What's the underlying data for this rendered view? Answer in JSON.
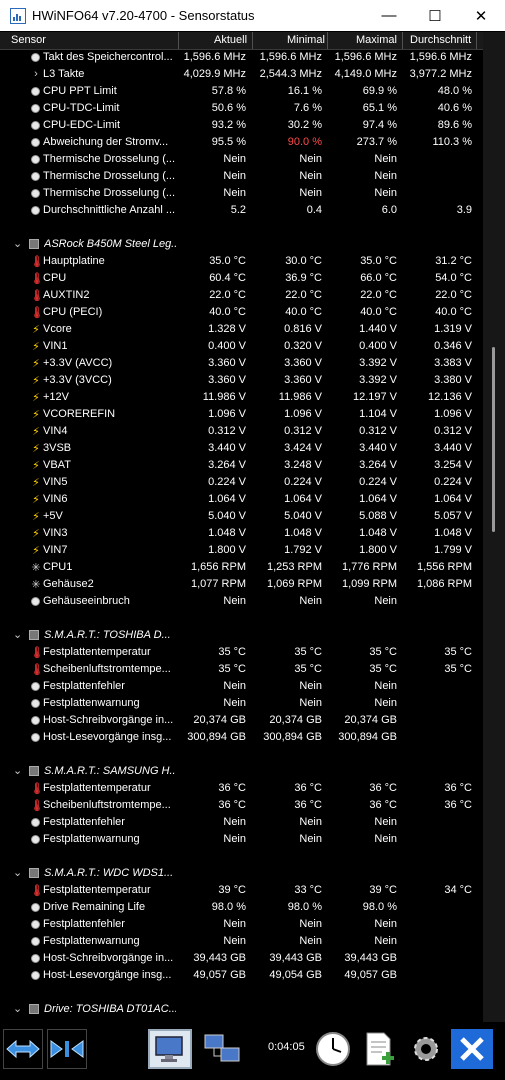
{
  "window": {
    "title": "HWiNFO64 v7.20-4700 - Sensorstatus",
    "minimize_glyph": "—",
    "maximize_glyph": "☐",
    "close_glyph": "✕"
  },
  "columns": {
    "sensor": "Sensor",
    "current": "Aktuell",
    "minimum": "Minimal",
    "maximum": "Maximal",
    "average": "Durchschnitt"
  },
  "rows": [
    {
      "kind": "item",
      "icon": "circle",
      "label": "Takt des Speichercontrol...",
      "cur": "1,596.6 MHz",
      "min": "1,596.6 MHz",
      "max": "1,596.6 MHz",
      "avg": "1,596.6 MHz"
    },
    {
      "kind": "item",
      "icon": "chevron",
      "label": "L3 Takte",
      "cur": "4,029.9 MHz",
      "min": "2,544.3 MHz",
      "max": "4,149.0 MHz",
      "avg": "3,977.2 MHz"
    },
    {
      "kind": "item",
      "icon": "circle",
      "label": "CPU PPT Limit",
      "cur": "57.8 %",
      "min": "16.1 %",
      "max": "69.9 %",
      "avg": "48.0 %"
    },
    {
      "kind": "item",
      "icon": "circle",
      "label": "CPU-TDC-Limit",
      "cur": "50.6 %",
      "min": "7.6 %",
      "max": "65.1 %",
      "avg": "40.6 %"
    },
    {
      "kind": "item",
      "icon": "circle",
      "label": "CPU-EDC-Limit",
      "cur": "93.2 %",
      "min": "30.2 %",
      "max": "97.4 %",
      "avg": "89.6 %"
    },
    {
      "kind": "item",
      "icon": "circle",
      "label": "Abweichung der Stromv...",
      "cur": "95.5 %",
      "min": "90.0 %",
      "min_red": true,
      "max": "273.7 %",
      "avg": "110.3 %"
    },
    {
      "kind": "item",
      "icon": "circle",
      "label": "Thermische Drosselung (...",
      "cur": "Nein",
      "min": "Nein",
      "max": "Nein",
      "avg": ""
    },
    {
      "kind": "item",
      "icon": "circle",
      "label": "Thermische Drosselung (...",
      "cur": "Nein",
      "min": "Nein",
      "max": "Nein",
      "avg": ""
    },
    {
      "kind": "item",
      "icon": "circle",
      "label": "Thermische Drosselung (...",
      "cur": "Nein",
      "min": "Nein",
      "max": "Nein",
      "avg": ""
    },
    {
      "kind": "item",
      "icon": "circle",
      "label": "Durchschnittliche Anzahl ...",
      "cur": "5.2",
      "min": "0.4",
      "max": "6.0",
      "avg": "3.9"
    },
    {
      "kind": "blank"
    },
    {
      "kind": "group",
      "label": "ASRock B450M Steel Leg..."
    },
    {
      "kind": "item",
      "icon": "therm",
      "label": "Hauptplatine",
      "cur": "35.0 °C",
      "min": "30.0 °C",
      "max": "35.0 °C",
      "avg": "31.2 °C"
    },
    {
      "kind": "item",
      "icon": "therm",
      "label": "CPU",
      "cur": "60.4 °C",
      "min": "36.9 °C",
      "max": "66.0 °C",
      "avg": "54.0 °C"
    },
    {
      "kind": "item",
      "icon": "therm",
      "label": "AUXTIN2",
      "cur": "22.0 °C",
      "min": "22.0 °C",
      "max": "22.0 °C",
      "avg": "22.0 °C"
    },
    {
      "kind": "item",
      "icon": "therm",
      "label": "CPU (PECI)",
      "cur": "40.0 °C",
      "min": "40.0 °C",
      "max": "40.0 °C",
      "avg": "40.0 °C"
    },
    {
      "kind": "item",
      "icon": "volt",
      "label": "Vcore",
      "cur": "1.328 V",
      "min": "0.816 V",
      "max": "1.440 V",
      "avg": "1.319 V"
    },
    {
      "kind": "item",
      "icon": "volt",
      "label": "VIN1",
      "cur": "0.400 V",
      "min": "0.320 V",
      "max": "0.400 V",
      "avg": "0.346 V"
    },
    {
      "kind": "item",
      "icon": "volt",
      "label": "+3.3V (AVCC)",
      "cur": "3.360 V",
      "min": "3.360 V",
      "max": "3.392 V",
      "avg": "3.383 V"
    },
    {
      "kind": "item",
      "icon": "volt",
      "label": "+3.3V (3VCC)",
      "cur": "3.360 V",
      "min": "3.360 V",
      "max": "3.392 V",
      "avg": "3.380 V"
    },
    {
      "kind": "item",
      "icon": "volt",
      "label": "+12V",
      "cur": "11.986 V",
      "min": "11.986 V",
      "max": "12.197 V",
      "avg": "12.136 V"
    },
    {
      "kind": "item",
      "icon": "volt",
      "label": "VCOREREFIN",
      "cur": "1.096 V",
      "min": "1.096 V",
      "max": "1.104 V",
      "avg": "1.096 V"
    },
    {
      "kind": "item",
      "icon": "volt",
      "label": "VIN4",
      "cur": "0.312 V",
      "min": "0.312 V",
      "max": "0.312 V",
      "avg": "0.312 V"
    },
    {
      "kind": "item",
      "icon": "volt",
      "label": "3VSB",
      "cur": "3.440 V",
      "min": "3.424 V",
      "max": "3.440 V",
      "avg": "3.440 V"
    },
    {
      "kind": "item",
      "icon": "volt",
      "label": "VBAT",
      "cur": "3.264 V",
      "min": "3.248 V",
      "max": "3.264 V",
      "avg": "3.254 V"
    },
    {
      "kind": "item",
      "icon": "volt",
      "label": "VIN5",
      "cur": "0.224 V",
      "min": "0.224 V",
      "max": "0.224 V",
      "avg": "0.224 V"
    },
    {
      "kind": "item",
      "icon": "volt",
      "label": "VIN6",
      "cur": "1.064 V",
      "min": "1.064 V",
      "max": "1.064 V",
      "avg": "1.064 V"
    },
    {
      "kind": "item",
      "icon": "volt",
      "label": "+5V",
      "cur": "5.040 V",
      "min": "5.040 V",
      "max": "5.088 V",
      "avg": "5.057 V"
    },
    {
      "kind": "item",
      "icon": "volt",
      "label": "VIN3",
      "cur": "1.048 V",
      "min": "1.048 V",
      "max": "1.048 V",
      "avg": "1.048 V"
    },
    {
      "kind": "item",
      "icon": "volt",
      "label": "VIN7",
      "cur": "1.800 V",
      "min": "1.792 V",
      "max": "1.800 V",
      "avg": "1.799 V"
    },
    {
      "kind": "item",
      "icon": "fan",
      "label": "CPU1",
      "cur": "1,656 RPM",
      "min": "1,253 RPM",
      "max": "1,776 RPM",
      "avg": "1,556 RPM"
    },
    {
      "kind": "item",
      "icon": "fan",
      "label": "Gehäuse2",
      "cur": "1,077 RPM",
      "min": "1,069 RPM",
      "max": "1,099 RPM",
      "avg": "1,086 RPM"
    },
    {
      "kind": "item",
      "icon": "circle",
      "label": "Gehäuseeinbruch",
      "cur": "Nein",
      "min": "Nein",
      "max": "Nein",
      "avg": ""
    },
    {
      "kind": "blank"
    },
    {
      "kind": "group",
      "label": "S.M.A.R.T.: TOSHIBA D..."
    },
    {
      "kind": "item",
      "icon": "therm",
      "label": "Festplattentemperatur",
      "cur": "35 °C",
      "min": "35 °C",
      "max": "35 °C",
      "avg": "35 °C"
    },
    {
      "kind": "item",
      "icon": "therm",
      "label": "Scheibenluftstromtempe...",
      "cur": "35 °C",
      "min": "35 °C",
      "max": "35 °C",
      "avg": "35 °C"
    },
    {
      "kind": "item",
      "icon": "circle",
      "label": "Festplattenfehler",
      "cur": "Nein",
      "min": "Nein",
      "max": "Nein",
      "avg": ""
    },
    {
      "kind": "item",
      "icon": "circle",
      "label": "Festplattenwarnung",
      "cur": "Nein",
      "min": "Nein",
      "max": "Nein",
      "avg": ""
    },
    {
      "kind": "item",
      "icon": "circle",
      "label": "Host-Schreibvorgänge in...",
      "cur": "20,374 GB",
      "min": "20,374 GB",
      "max": "20,374 GB",
      "avg": ""
    },
    {
      "kind": "item",
      "icon": "circle",
      "label": "Host-Lesevorgänge insg...",
      "cur": "300,894 GB",
      "min": "300,894 GB",
      "max": "300,894 GB",
      "avg": ""
    },
    {
      "kind": "blank"
    },
    {
      "kind": "group",
      "label": "S.M.A.R.T.: SAMSUNG H..."
    },
    {
      "kind": "item",
      "icon": "therm",
      "label": "Festplattentemperatur",
      "cur": "36 °C",
      "min": "36 °C",
      "max": "36 °C",
      "avg": "36 °C"
    },
    {
      "kind": "item",
      "icon": "therm",
      "label": "Scheibenluftstromtempe...",
      "cur": "36 °C",
      "min": "36 °C",
      "max": "36 °C",
      "avg": "36 °C"
    },
    {
      "kind": "item",
      "icon": "circle",
      "label": "Festplattenfehler",
      "cur": "Nein",
      "min": "Nein",
      "max": "Nein",
      "avg": ""
    },
    {
      "kind": "item",
      "icon": "circle",
      "label": "Festplattenwarnung",
      "cur": "Nein",
      "min": "Nein",
      "max": "Nein",
      "avg": ""
    },
    {
      "kind": "blank"
    },
    {
      "kind": "group",
      "label": "S.M.A.R.T.: WDC WDS1..."
    },
    {
      "kind": "item",
      "icon": "therm",
      "label": "Festplattentemperatur",
      "cur": "39 °C",
      "min": "33 °C",
      "max": "39 °C",
      "avg": "34 °C"
    },
    {
      "kind": "item",
      "icon": "circle",
      "label": "Drive Remaining Life",
      "cur": "98.0 %",
      "min": "98.0 %",
      "max": "98.0 %",
      "avg": ""
    },
    {
      "kind": "item",
      "icon": "circle",
      "label": "Festplattenfehler",
      "cur": "Nein",
      "min": "Nein",
      "max": "Nein",
      "avg": ""
    },
    {
      "kind": "item",
      "icon": "circle",
      "label": "Festplattenwarnung",
      "cur": "Nein",
      "min": "Nein",
      "max": "Nein",
      "avg": ""
    },
    {
      "kind": "item",
      "icon": "circle",
      "label": "Host-Schreibvorgänge in...",
      "cur": "39,443 GB",
      "min": "39,443 GB",
      "max": "39,443 GB",
      "avg": ""
    },
    {
      "kind": "item",
      "icon": "circle",
      "label": "Host-Lesevorgänge insg...",
      "cur": "49,057 GB",
      "min": "49,054 GB",
      "max": "49,057 GB",
      "avg": ""
    },
    {
      "kind": "blank"
    },
    {
      "kind": "group",
      "label": "Drive: TOSHIBA DT01AC..."
    }
  ],
  "icons": {
    "circle": "status-dot-icon",
    "chevron": "expand-chevron-icon",
    "therm": "thermometer-icon",
    "volt": "lightning-icon",
    "fan": "fan-icon",
    "group": "chip-icon"
  },
  "toolbar": {
    "elapsed": "0:04:05"
  },
  "colors": {
    "background": "#000000",
    "text": "#ffffff",
    "alert": "#ff4a4a",
    "volt_icon": "#ffcc00",
    "therm_icon": "#e03030",
    "close_button": "#1e6ad8",
    "arrows": "#3b8fe0"
  }
}
